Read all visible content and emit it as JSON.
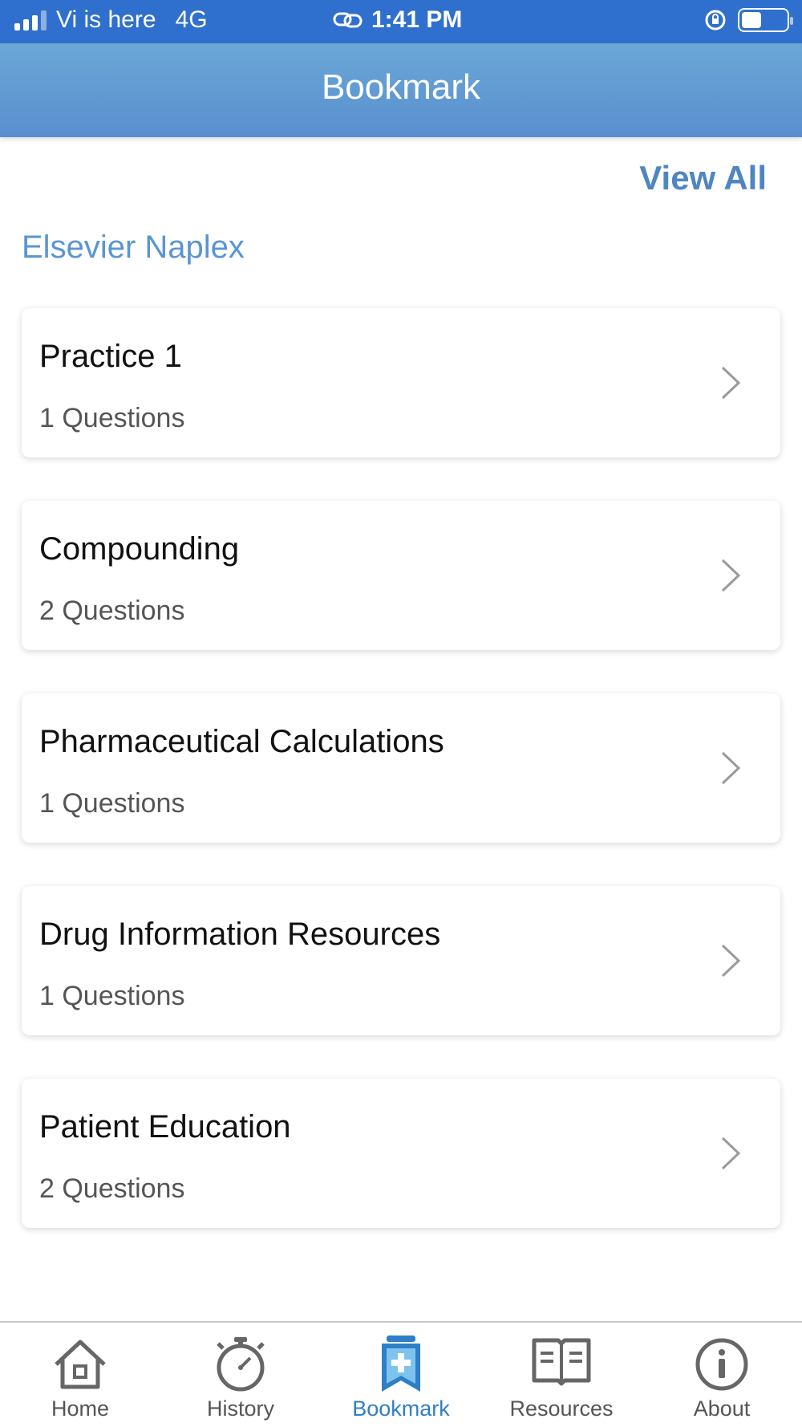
{
  "status_bar": {
    "carrier": "Vi is here",
    "network": "4G",
    "time": "1:41 PM",
    "battery_level": 0.45
  },
  "header": {
    "title": "Bookmark"
  },
  "view_all_label": "View All",
  "section_title": "Elsevier Naplex",
  "cards": [
    {
      "title": "Practice 1",
      "count": "1 Questions"
    },
    {
      "title": "Compounding",
      "count": "2 Questions"
    },
    {
      "title": "Pharmaceutical Calculations",
      "count": "1 Questions"
    },
    {
      "title": "Drug Information Resources",
      "count": "1 Questions"
    },
    {
      "title": "Patient Education",
      "count": "2 Questions"
    }
  ],
  "tabs": [
    {
      "label": "Home",
      "icon": "home-icon",
      "active": false
    },
    {
      "label": "History",
      "icon": "stopwatch-icon",
      "active": false
    },
    {
      "label": "Bookmark",
      "icon": "bookmark-icon",
      "active": true
    },
    {
      "label": "Resources",
      "icon": "open-book-icon",
      "active": false
    },
    {
      "label": "About",
      "icon": "info-icon",
      "active": false
    }
  ],
  "colors": {
    "status_bar": "#2f6fce",
    "header": "#5a8fcf",
    "accent": "#4f86c1",
    "active_tab": "#2f7fc6"
  }
}
